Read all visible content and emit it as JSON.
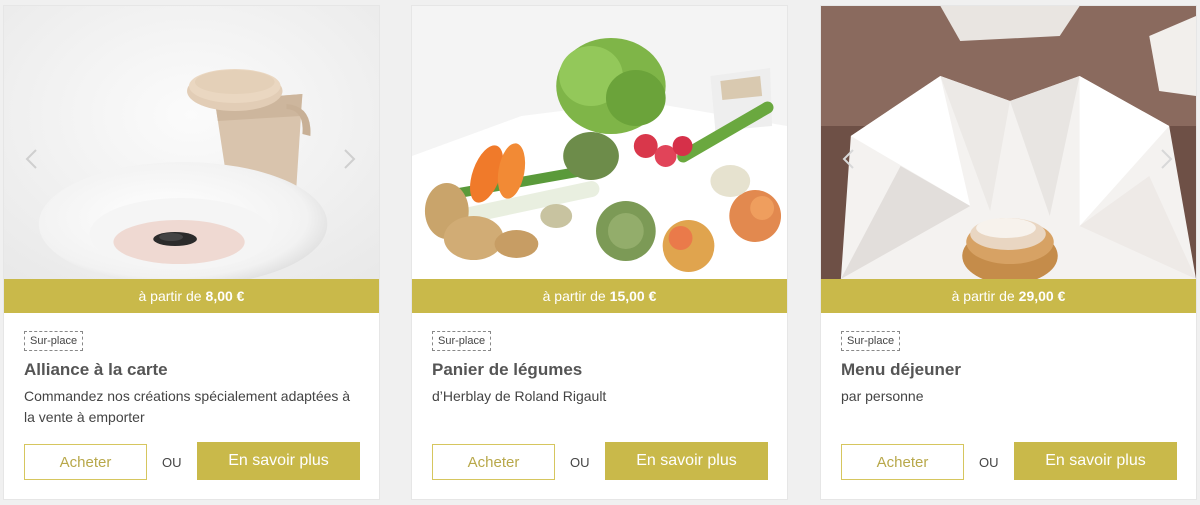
{
  "theme": {
    "accent": "#c9b94a",
    "buy_border": "#d6c65e",
    "buy_text": "#b8a84a"
  },
  "cards": [
    {
      "price_prefix": "à partir de",
      "price": "8,00 €",
      "badge": "Sur-place",
      "title": "Alliance à la carte",
      "description": "Commandez nos créations spécialement adaptées à la vente à emporter",
      "buy_label": "Acheter",
      "or_label": "OU",
      "more_label": "En savoir plus",
      "prev_icon": "chevron-left-icon",
      "next_icon": "chevron-right-icon"
    },
    {
      "price_prefix": "à partir de",
      "price": "15,00 €",
      "badge": "Sur-place",
      "title": "Panier de légumes",
      "description": "d’Herblay de Roland Rigault",
      "buy_label": "Acheter",
      "or_label": "OU",
      "more_label": "En savoir plus"
    },
    {
      "price_prefix": "à partir de",
      "price": "29,00 €",
      "badge": "Sur-place",
      "title": "Menu déjeuner",
      "description": "par personne",
      "buy_label": "Acheter",
      "or_label": "OU",
      "more_label": "En savoir plus",
      "prev_icon": "chevron-left-icon",
      "next_icon": "chevron-right-icon"
    }
  ]
}
